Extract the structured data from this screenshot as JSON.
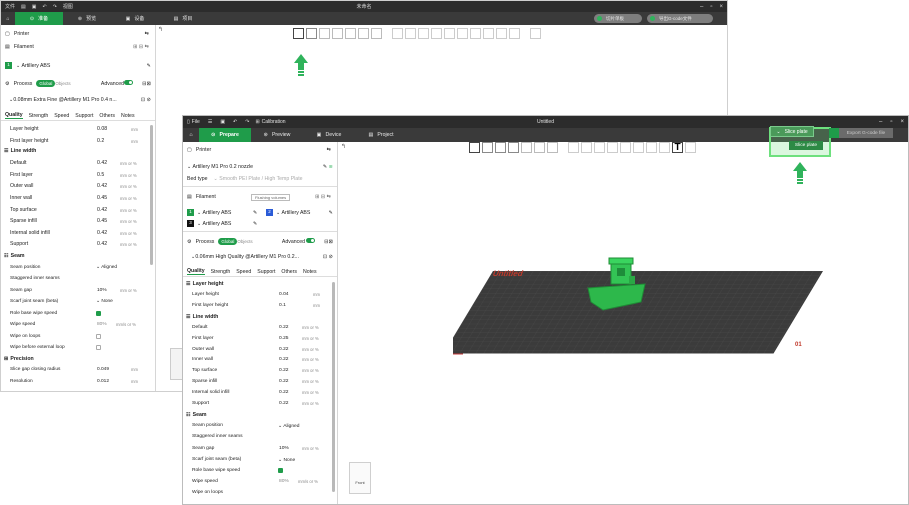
{
  "back_window": {
    "title_menu": [
      "文件",
      "编辑",
      "视图"
    ],
    "title": "未命名",
    "tabs": [
      "准备",
      "预览",
      "设备",
      "项目"
    ],
    "pills": [
      "切片单板",
      "导出G-code文件"
    ],
    "printer_label": "Printer",
    "filament_label": "Filament",
    "filament_item": "Artillery ABS",
    "process_label": "Process",
    "process_global": "Global",
    "process_objects": "Objects",
    "advanced_label": "Advanced",
    "process_profile": "0.08mm Extra Fine @Artillery M1 Pro 0.4 n...",
    "tabs_settings": [
      "Quality",
      "Strength",
      "Speed",
      "Support",
      "Others",
      "Notes"
    ],
    "rows_layer": [
      {
        "label": "Layer height",
        "value": "0.08",
        "unit": "mm"
      },
      {
        "label": "First layer height",
        "value": "0.2",
        "unit": "mm"
      }
    ],
    "line_width_header": "Line width",
    "rows_width": [
      {
        "label": "Default",
        "value": "0.42",
        "unit": "mm or %"
      },
      {
        "label": "First layer",
        "value": "0.5",
        "unit": "mm or %"
      },
      {
        "label": "Outer wall",
        "value": "0.42",
        "unit": "mm or %"
      },
      {
        "label": "Inner wall",
        "value": "0.45",
        "unit": "mm or %"
      },
      {
        "label": "Top surface",
        "value": "0.42",
        "unit": "mm or %"
      },
      {
        "label": "Sparse infill",
        "value": "0.45",
        "unit": "mm or %"
      },
      {
        "label": "Internal solid infill",
        "value": "0.42",
        "unit": "mm or %"
      },
      {
        "label": "Support",
        "value": "0.42",
        "unit": "mm or %"
      }
    ],
    "seam_header": "Seam",
    "seam_position_label": "Seam position",
    "seam_position_value": "Aligned",
    "staggered_label": "Staggered inner seams",
    "seam_gap_label": "Seam gap",
    "seam_gap_value": "10%",
    "seam_gap_unit": "mm or %",
    "scarf_label": "Scarf joint seam (beta)",
    "scarf_value": "None",
    "role_base_label": "Role base wipe speed",
    "wipe_speed_label": "Wipe speed",
    "wipe_speed_value": "80%",
    "wipe_speed_unit": "mm/s or %",
    "wipe_loops_label": "Wipe on loops",
    "wipe_before_label": "Wipe before external loop",
    "precision_header": "Precision",
    "slice_gap_label": "Slice gap closing radius",
    "slice_gap_value": "0.049",
    "slice_gap_unit": "mm",
    "resolution_label": "Resolution",
    "resolution_value": "0.012",
    "resolution_unit": "mm"
  },
  "front_window": {
    "file_label": "File",
    "title": "Untitled",
    "calibration_label": "Calibration",
    "tabs": [
      "Prepare",
      "Preview",
      "Device",
      "Project"
    ],
    "slice_button": "Slice plate",
    "slice_menu_item": "Slice plate",
    "export_button": "Export G-code file",
    "printer_label": "Printer",
    "printer_profile": "Artillery M1 Pro 0.2 nozzle",
    "bed_type_label": "Bed type",
    "bed_type_value": "Smooth PEI Plate / High Temp Plate",
    "filament_label": "Filament",
    "flushing_label": "Flushing volumes",
    "filaments": [
      {
        "slot": "1",
        "name": "Artillery ABS",
        "color": "#1f9c4a"
      },
      {
        "slot": "2",
        "name": "Artillery ABS",
        "color": "#2a5bd7"
      },
      {
        "slot": "3",
        "name": "Artillery ABS",
        "color": "#111111"
      }
    ],
    "process_label": "Process",
    "process_global": "Global",
    "process_objects": "Objects",
    "advanced_label": "Advanced",
    "process_profile": "0.06mm High Quality @Artillery M1 Pro 0.2...",
    "tabs_settings": [
      "Quality",
      "Strength",
      "Speed",
      "Support",
      "Others",
      "Notes"
    ],
    "layer_height_header": "Layer height",
    "rows_layer": [
      {
        "label": "Layer height",
        "value": "0.04",
        "unit": "mm"
      },
      {
        "label": "First layer height",
        "value": "0.1",
        "unit": "mm"
      }
    ],
    "line_width_header": "Line width",
    "rows_width": [
      {
        "label": "Default",
        "value": "0.22",
        "unit": "mm or %"
      },
      {
        "label": "First layer",
        "value": "0.25",
        "unit": "mm or %"
      },
      {
        "label": "Outer wall",
        "value": "0.22",
        "unit": "mm or %"
      },
      {
        "label": "Inner wall",
        "value": "0.22",
        "unit": "mm or %"
      },
      {
        "label": "Top surface",
        "value": "0.22",
        "unit": "mm or %"
      },
      {
        "label": "Sparse infill",
        "value": "0.22",
        "unit": "mm or %"
      },
      {
        "label": "Internal solid infill",
        "value": "0.22",
        "unit": "mm or %"
      },
      {
        "label": "Support",
        "value": "0.22",
        "unit": "mm or %"
      }
    ],
    "seam_header": "Seam",
    "seam_position_label": "Seam position",
    "seam_position_value": "Aligned",
    "staggered_label": "Staggered inner seams",
    "seam_gap_label": "Seam gap",
    "seam_gap_value": "10%",
    "seam_gap_unit": "mm or %",
    "scarf_label": "Scarf joint seam (beta)",
    "scarf_value": "None",
    "role_base_label": "Role base wipe speed",
    "wipe_speed_label": "Wipe speed",
    "wipe_speed_value": "80%",
    "wipe_speed_unit": "mm/s or %",
    "wipe_loops_label": "Wipe on loops",
    "plate_label": "Untitled",
    "plate_number": "01",
    "view_cube_label": "Front"
  },
  "colors": {
    "accent": "#1f9c4a",
    "highlight": "#6ee07e",
    "titlebar": "#2c2c2c",
    "tabbar": "#3a3a3a",
    "plate": "#3a3a3a",
    "model": "#2db84b"
  },
  "icons": [
    "home-icon",
    "printer-icon",
    "filament-icon",
    "process-icon",
    "cube-icon",
    "grid-icon",
    "arrow-icon",
    "text-tool-icon"
  ]
}
